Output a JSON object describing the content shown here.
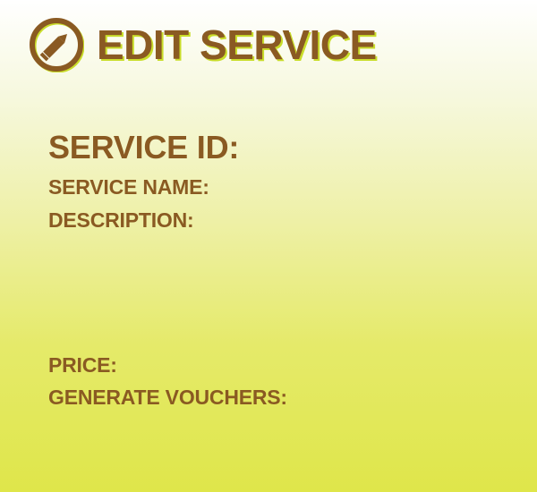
{
  "header": {
    "title": "EDIT SERVICE",
    "icon": "pencil-circle-icon"
  },
  "form": {
    "service_id_label": "SERVICE ID:",
    "service_name_label": "SERVICE NAME:",
    "description_label": "DESCRIPTION:",
    "price_label": "PRICE:",
    "generate_vouchers_label": "GENERATE VOUCHERS:"
  },
  "colors": {
    "text": "#8a5a22",
    "accent_outline": "#c9dd2a",
    "background_top": "#ffffff",
    "background_bottom": "#dfe64a"
  }
}
